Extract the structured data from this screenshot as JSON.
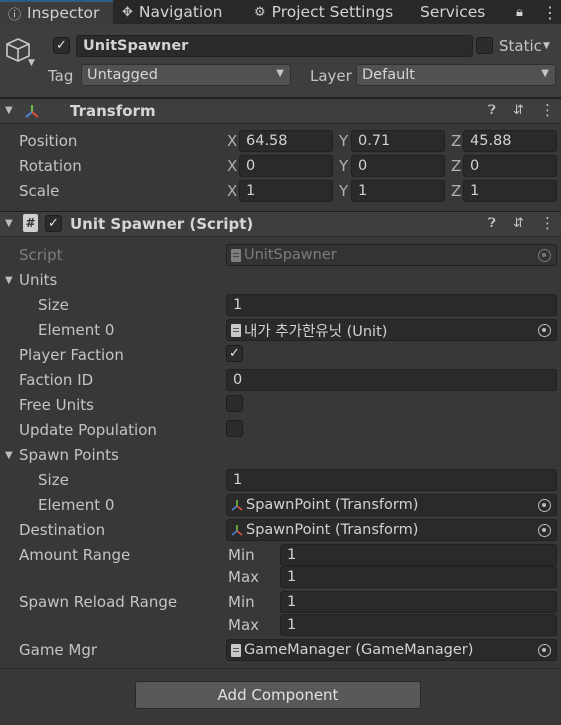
{
  "tabs": [
    {
      "label": "Inspector",
      "icon": "info-icon"
    },
    {
      "label": "Navigation",
      "icon": "navigation-icon"
    },
    {
      "label": "Project Settings",
      "icon": "gear-icon"
    },
    {
      "label": "Services",
      "icon": ""
    }
  ],
  "gameobject": {
    "name": "UnitSpawner",
    "active": true,
    "static_label": "Static",
    "tag_label": "Tag",
    "tag_value": "Untagged",
    "layer_label": "Layer",
    "layer_value": "Default"
  },
  "transform": {
    "title": "Transform",
    "rows": [
      {
        "label": "Position",
        "x": "64.58",
        "y": "0.71",
        "z": "45.88"
      },
      {
        "label": "Rotation",
        "x": "0",
        "y": "0",
        "z": "0"
      },
      {
        "label": "Scale",
        "x": "1",
        "y": "1",
        "z": "1"
      }
    ],
    "axes": [
      "X",
      "Y",
      "Z"
    ]
  },
  "script_component": {
    "title": "Unit Spawner (Script)",
    "enabled": true,
    "script_label": "Script",
    "script_value": "UnitSpawner",
    "units_label": "Units",
    "units_size_label": "Size",
    "units_size": "1",
    "units_element0_label": "Element 0",
    "units_element0": "내가 추가한유닛 (Unit)",
    "player_faction_label": "Player Faction",
    "player_faction": true,
    "faction_id_label": "Faction ID",
    "faction_id": "0",
    "free_units_label": "Free Units",
    "free_units": false,
    "update_population_label": "Update Population",
    "update_population": false,
    "spawn_points_label": "Spawn Points",
    "spawn_size_label": "Size",
    "spawn_size": "1",
    "spawn_element0_label": "Element 0",
    "spawn_element0": "SpawnPoint (Transform)",
    "destination_label": "Destination",
    "destination": "SpawnPoint (Transform)",
    "amount_range_label": "Amount Range",
    "amount_min_label": "Min",
    "amount_min": "1",
    "amount_max_label": "Max",
    "amount_max": "1",
    "reload_range_label": "Spawn Reload Range",
    "reload_min_label": "Min",
    "reload_min": "1",
    "reload_max_label": "Max",
    "reload_max": "1",
    "game_mgr_label": "Game Mgr",
    "game_mgr": "GameManager (GameManager)"
  },
  "add_component_label": "Add Component",
  "colors": {
    "background": "#383838",
    "tab_bar": "#282828",
    "field": "#2a2a2a",
    "accent_tab": "#2c5d87"
  }
}
